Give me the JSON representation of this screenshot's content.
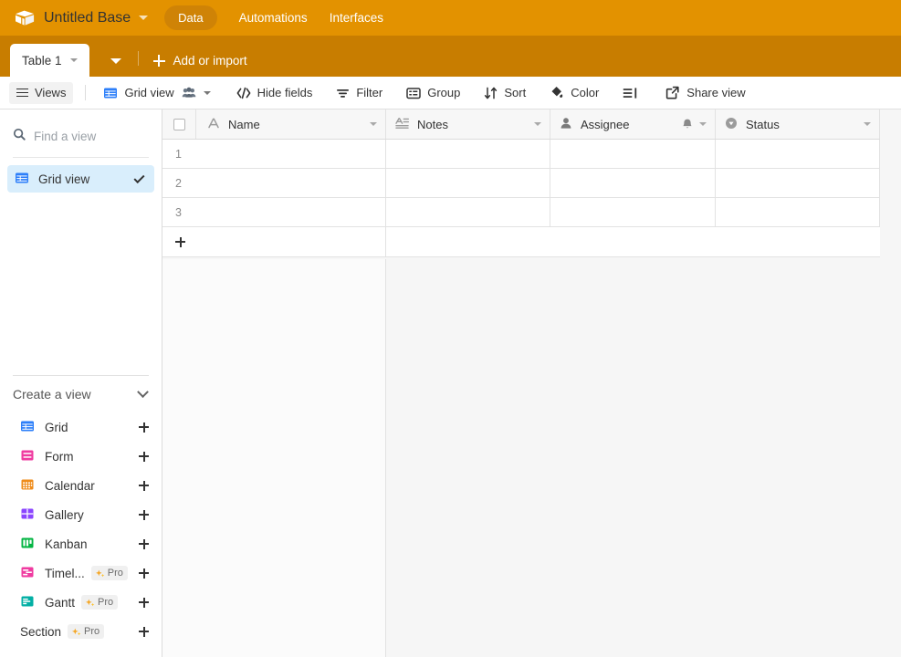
{
  "header": {
    "logo_icon": "airtable-cube-icon",
    "base_title": "Untitled Base",
    "base_caret_icon": "chevron-down-icon",
    "nav": [
      {
        "label": "Data",
        "active": true
      },
      {
        "label": "Automations",
        "active": false
      },
      {
        "label": "Interfaces",
        "active": false
      }
    ],
    "colors": {
      "topbar": "#e39200",
      "tabstrip": "#c87d00"
    }
  },
  "tabstrip": {
    "active_tab": "Table 1",
    "tab_caret_icon": "chevron-down-icon",
    "strip_caret_icon": "chevron-down-icon",
    "add_label": "Add or import",
    "add_icon": "plus-icon"
  },
  "toolbar": {
    "views_label": "Views",
    "views_icon": "hamburger-icon",
    "view_name": "Grid view",
    "view_icon": "grid-icon",
    "collaborators_icon": "people-icon",
    "view_caret_icon": "chevron-down-icon",
    "items": [
      {
        "label": "Hide fields",
        "icon": "hide-fields-icon"
      },
      {
        "label": "Filter",
        "icon": "filter-icon"
      },
      {
        "label": "Group",
        "icon": "group-icon"
      },
      {
        "label": "Sort",
        "icon": "sort-icon"
      },
      {
        "label": "Color",
        "icon": "color-icon"
      },
      {
        "label": "",
        "icon": "row-height-icon"
      },
      {
        "label": "Share view",
        "icon": "share-icon"
      }
    ]
  },
  "sidebar": {
    "search": {
      "placeholder": "Find a view",
      "value": "",
      "icon": "search-icon"
    },
    "views": [
      {
        "label": "Grid view",
        "icon": "grid-icon",
        "selected": true,
        "check_icon": "check-icon"
      }
    ],
    "create": {
      "label": "Create a view",
      "caret_icon": "chevron-down-icon",
      "add_icon": "plus-icon",
      "pro_label": "Pro",
      "pro_icon": "sparkle-icon",
      "types": [
        {
          "label": "Grid",
          "icon": "grid-view-icon",
          "color": "#2d7ff9",
          "pro": false
        },
        {
          "label": "Form",
          "icon": "form-view-icon",
          "color": "#ef3ba0",
          "pro": false
        },
        {
          "label": "Calendar",
          "icon": "calendar-view-icon",
          "color": "#ef8c1b",
          "pro": false
        },
        {
          "label": "Gallery",
          "icon": "gallery-view-icon",
          "color": "#8b46ff",
          "pro": false
        },
        {
          "label": "Kanban",
          "icon": "kanban-view-icon",
          "color": "#04b543",
          "pro": false
        },
        {
          "label": "Timel...",
          "icon": "timeline-view-icon",
          "color": "#ef3ba0",
          "pro": true
        },
        {
          "label": "Gantt",
          "icon": "gantt-view-icon",
          "color": "#02afa4",
          "pro": true
        },
        {
          "label": "Section",
          "icon": "",
          "color": "",
          "pro": true
        }
      ]
    }
  },
  "grid": {
    "select_all_icon": "checkbox-icon",
    "columns": [
      {
        "name": "Name",
        "icon": "text-field-icon",
        "caret_icon": "chevron-down-icon"
      },
      {
        "name": "Notes",
        "icon": "long-text-field-icon",
        "caret_icon": "chevron-down-icon"
      },
      {
        "name": "Assignee",
        "icon": "user-field-icon",
        "caret_icon": "chevron-down-icon",
        "extra_icon": "bell-icon"
      },
      {
        "name": "Status",
        "icon": "single-select-field-icon",
        "caret_icon": "chevron-down-icon"
      }
    ],
    "rows": [
      {
        "num": "1",
        "Name": "",
        "Notes": "",
        "Assignee": "",
        "Status": ""
      },
      {
        "num": "2",
        "Name": "",
        "Notes": "",
        "Assignee": "",
        "Status": ""
      },
      {
        "num": "3",
        "Name": "",
        "Notes": "",
        "Assignee": "",
        "Status": ""
      }
    ],
    "add_row_icon": "plus-icon"
  }
}
